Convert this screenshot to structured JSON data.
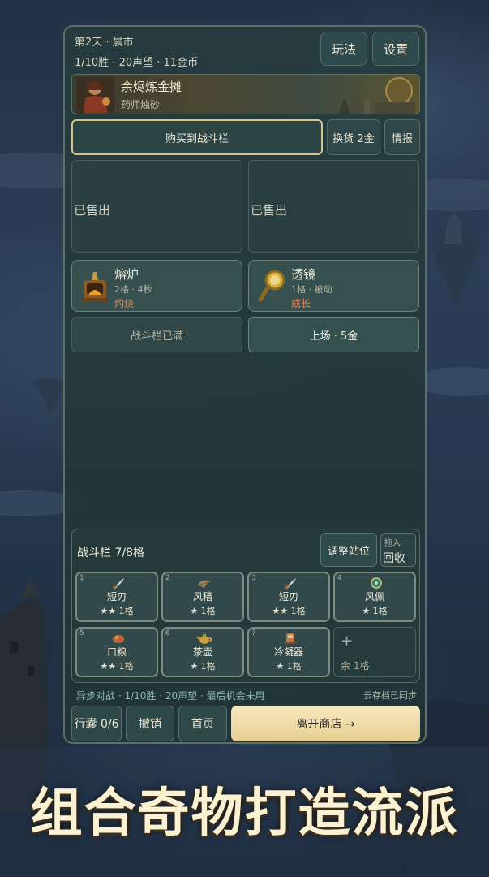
{
  "header": {
    "day_phase": "第2天 · 晨市",
    "stats": "1/10胜 · 20声望 · 11金币",
    "rules_label": "玩法",
    "settings_label": "设置"
  },
  "merchant": {
    "name": "余烬炼金摊",
    "subtitle": "药师烛砂"
  },
  "shop_actions": {
    "buy_label": "购买到战斗栏",
    "reroll_label": "换货 2金",
    "info_label": "情报"
  },
  "sold_slots": [
    "已售出",
    "已售出"
  ],
  "shop_items": [
    {
      "name": "熔炉",
      "meta": "2格 · 4秒",
      "tag": "灼烧",
      "icon": "furnace-icon",
      "button": "战斗栏已满"
    },
    {
      "name": "透镜",
      "meta": "1格 · 被动",
      "tag": "成长",
      "icon": "magnifier-icon",
      "button": "上场 · 5金"
    }
  ],
  "battle_bar": {
    "title": "战斗栏 7/8格",
    "adjust_label": "调整站位",
    "drag_hint": "拖入",
    "recycle_label": "回收",
    "slots": [
      {
        "index": "1",
        "name": "短刃",
        "meta": "★★ 1格",
        "icon": "dagger-icon"
      },
      {
        "index": "2",
        "name": "风穑",
        "meta": "★ 1格",
        "icon": "wind-icon"
      },
      {
        "index": "3",
        "name": "短刃",
        "meta": "★★ 1格",
        "icon": "dagger-icon"
      },
      {
        "index": "4",
        "name": "风佩",
        "meta": "★ 1格",
        "icon": "amulet-icon"
      },
      {
        "index": "5",
        "name": "口粮",
        "meta": "★★ 1格",
        "icon": "ration-icon"
      },
      {
        "index": "6",
        "name": "茶壶",
        "meta": "★ 1格",
        "icon": "teapot-icon"
      },
      {
        "index": "7",
        "name": "冷凝器",
        "meta": "★ 1格",
        "icon": "condenser-icon"
      }
    ],
    "empty_slot": {
      "plus": "+",
      "label": "余 1格"
    }
  },
  "status_line": "异步对战 · 1/10胜 · 20声望 · 最后机会未用",
  "sync_status": "云存档已同步",
  "footer": {
    "bag_label": "行囊 0/6",
    "undo_label": "撤销",
    "home_label": "首页",
    "leave_label": "离开商店 →"
  },
  "promo_text": "组合奇物打造流派",
  "colors": {
    "accent_gold": "#d8c48a",
    "leave_button": "#f2e2b2",
    "tag_orange": "#e0875a",
    "status_teal": "#8fb5b0"
  }
}
